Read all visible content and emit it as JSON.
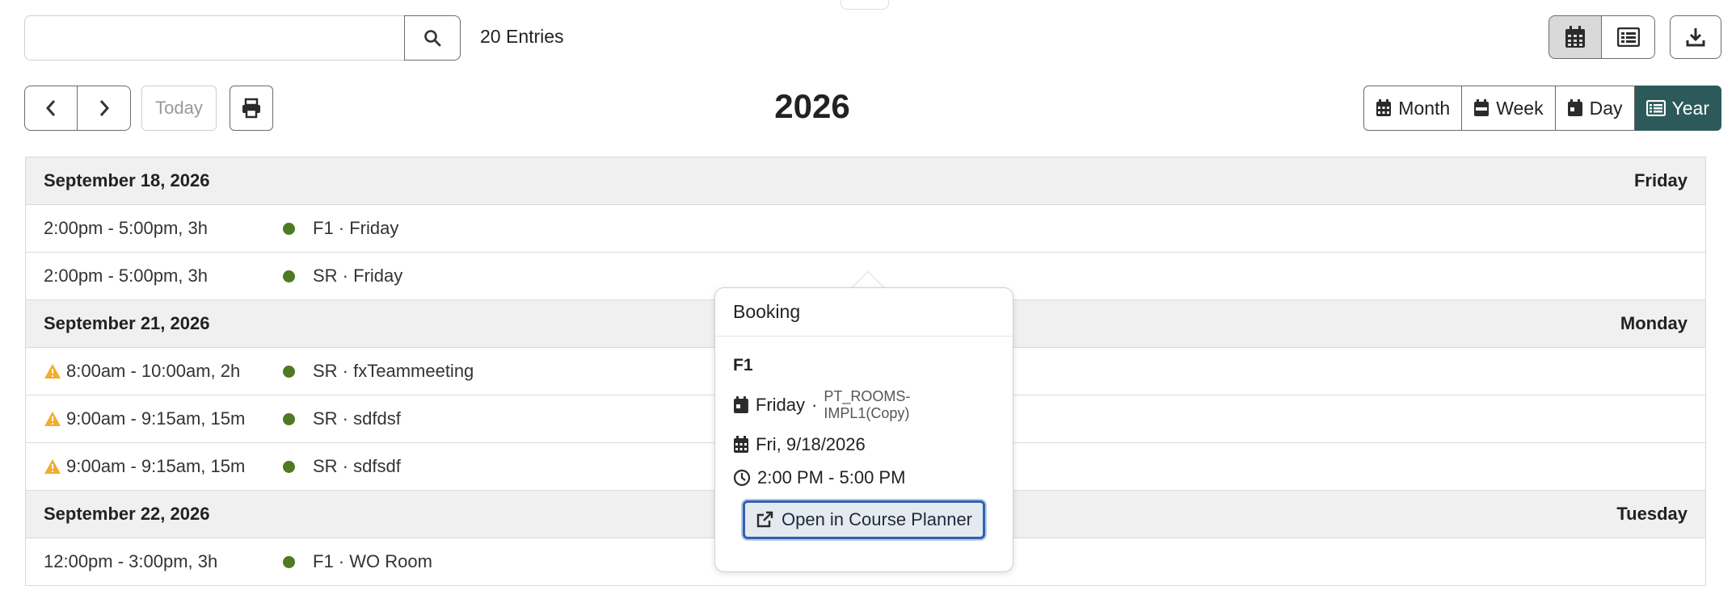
{
  "toolbar": {
    "search_placeholder": "",
    "entries_label": "20 Entries",
    "today_label": "Today",
    "year_title": "2026",
    "ranges": [
      "Month",
      "Week",
      "Day",
      "Year"
    ],
    "active_range": "Year"
  },
  "days": [
    {
      "date": "September 18, 2026",
      "weekday": "Friday",
      "events": [
        {
          "time": "2:00pm - 5:00pm, 3h",
          "title": "F1 · Friday",
          "warning": false
        },
        {
          "time": "2:00pm - 5:00pm, 3h",
          "title": "SR · Friday",
          "warning": false
        }
      ]
    },
    {
      "date": "September 21, 2026",
      "weekday": "Monday",
      "events": [
        {
          "time": "8:00am - 10:00am, 2h",
          "title": "SR · fxTeammeeting",
          "warning": true
        },
        {
          "time": "9:00am - 9:15am, 15m",
          "title": "SR · sdfdsf",
          "warning": true
        },
        {
          "time": "9:00am - 9:15am, 15m",
          "title": "SR · sdfsdf",
          "warning": true
        }
      ]
    },
    {
      "date": "September 22, 2026",
      "weekday": "Tuesday",
      "events": [
        {
          "time": "12:00pm - 3:00pm, 3h",
          "title": "F1 · WO Room",
          "warning": false
        }
      ]
    }
  ],
  "popover": {
    "header": "Booking",
    "title": "F1",
    "event_name": "Friday",
    "separator": "·",
    "event_source": "PT_ROOMS-IMPL1(Copy)",
    "date": "Fri, 9/18/2026",
    "time": "2:00 PM - 5:00 PM",
    "link_label": "Open in Course Planner"
  },
  "colors": {
    "accent": "#2c5a5b",
    "event_dot": "#4e7a22",
    "warning": "#f0ad2e",
    "link_border": "#2f62b0"
  }
}
